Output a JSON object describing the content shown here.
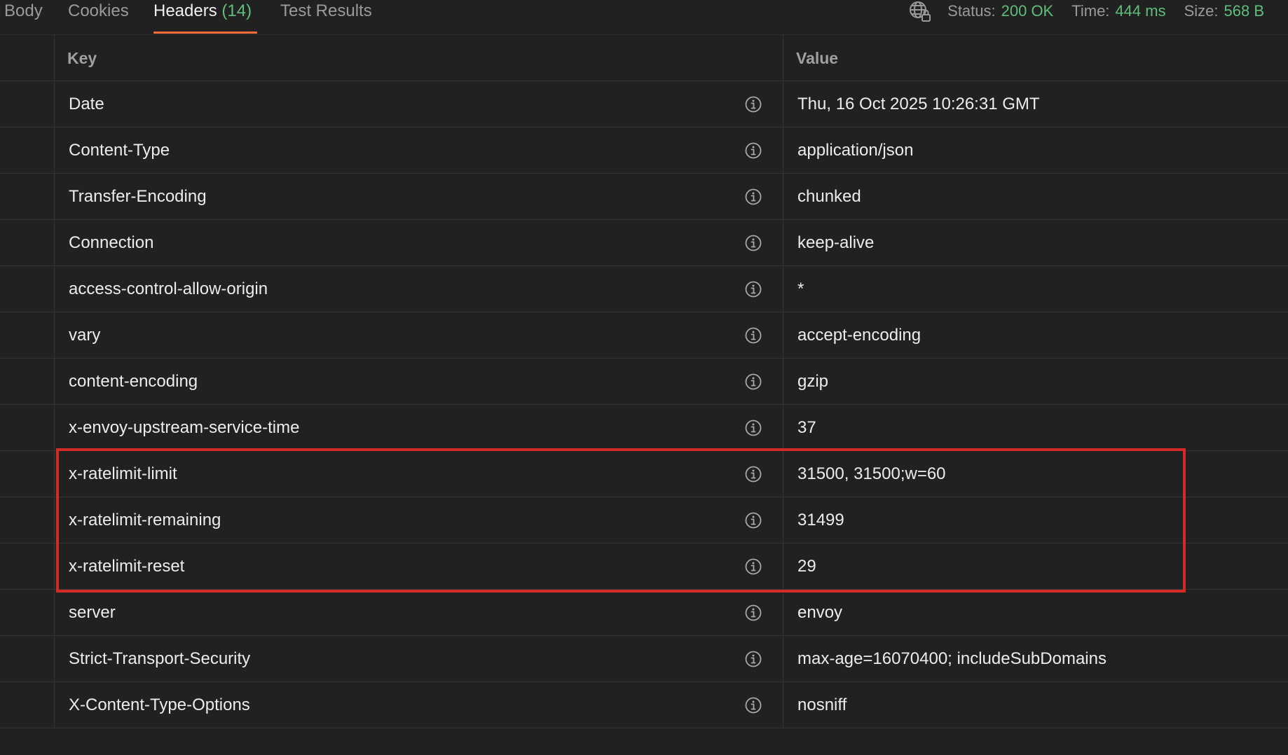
{
  "tabs": [
    {
      "label": "Body",
      "count": ""
    },
    {
      "label": "Cookies",
      "count": ""
    },
    {
      "label": "Headers",
      "count": "(14)"
    },
    {
      "label": "Test Results",
      "count": ""
    }
  ],
  "active_tab": "Headers",
  "status": {
    "status_label": "Status:",
    "status_value": "200 OK",
    "time_label": "Time:",
    "time_value": "444 ms",
    "size_label": "Size:",
    "size_value": "568 B"
  },
  "table": {
    "columns": {
      "key": "Key",
      "value": "Value"
    },
    "rows": [
      {
        "key": "Date",
        "value": "Thu, 16 Oct 2025 10:26:31 GMT"
      },
      {
        "key": "Content-Type",
        "value": "application/json"
      },
      {
        "key": "Transfer-Encoding",
        "value": "chunked"
      },
      {
        "key": "Connection",
        "value": "keep-alive"
      },
      {
        "key": "access-control-allow-origin",
        "value": "*"
      },
      {
        "key": "vary",
        "value": "accept-encoding"
      },
      {
        "key": "content-encoding",
        "value": "gzip"
      },
      {
        "key": "x-envoy-upstream-service-time",
        "value": "37"
      },
      {
        "key": "x-ratelimit-limit",
        "value": "31500, 31500;w=60"
      },
      {
        "key": "x-ratelimit-remaining",
        "value": "31499"
      },
      {
        "key": "x-ratelimit-reset",
        "value": "29"
      },
      {
        "key": "server",
        "value": "envoy"
      },
      {
        "key": "Strict-Transport-Security",
        "value": "max-age=16070400; includeSubDomains"
      },
      {
        "key": "X-Content-Type-Options",
        "value": "nosniff"
      }
    ]
  },
  "colors": {
    "background": "#212121",
    "accent_tab": "#ff6c37",
    "status_green": "#5fbf7a",
    "highlight_red": "#d42b27"
  }
}
